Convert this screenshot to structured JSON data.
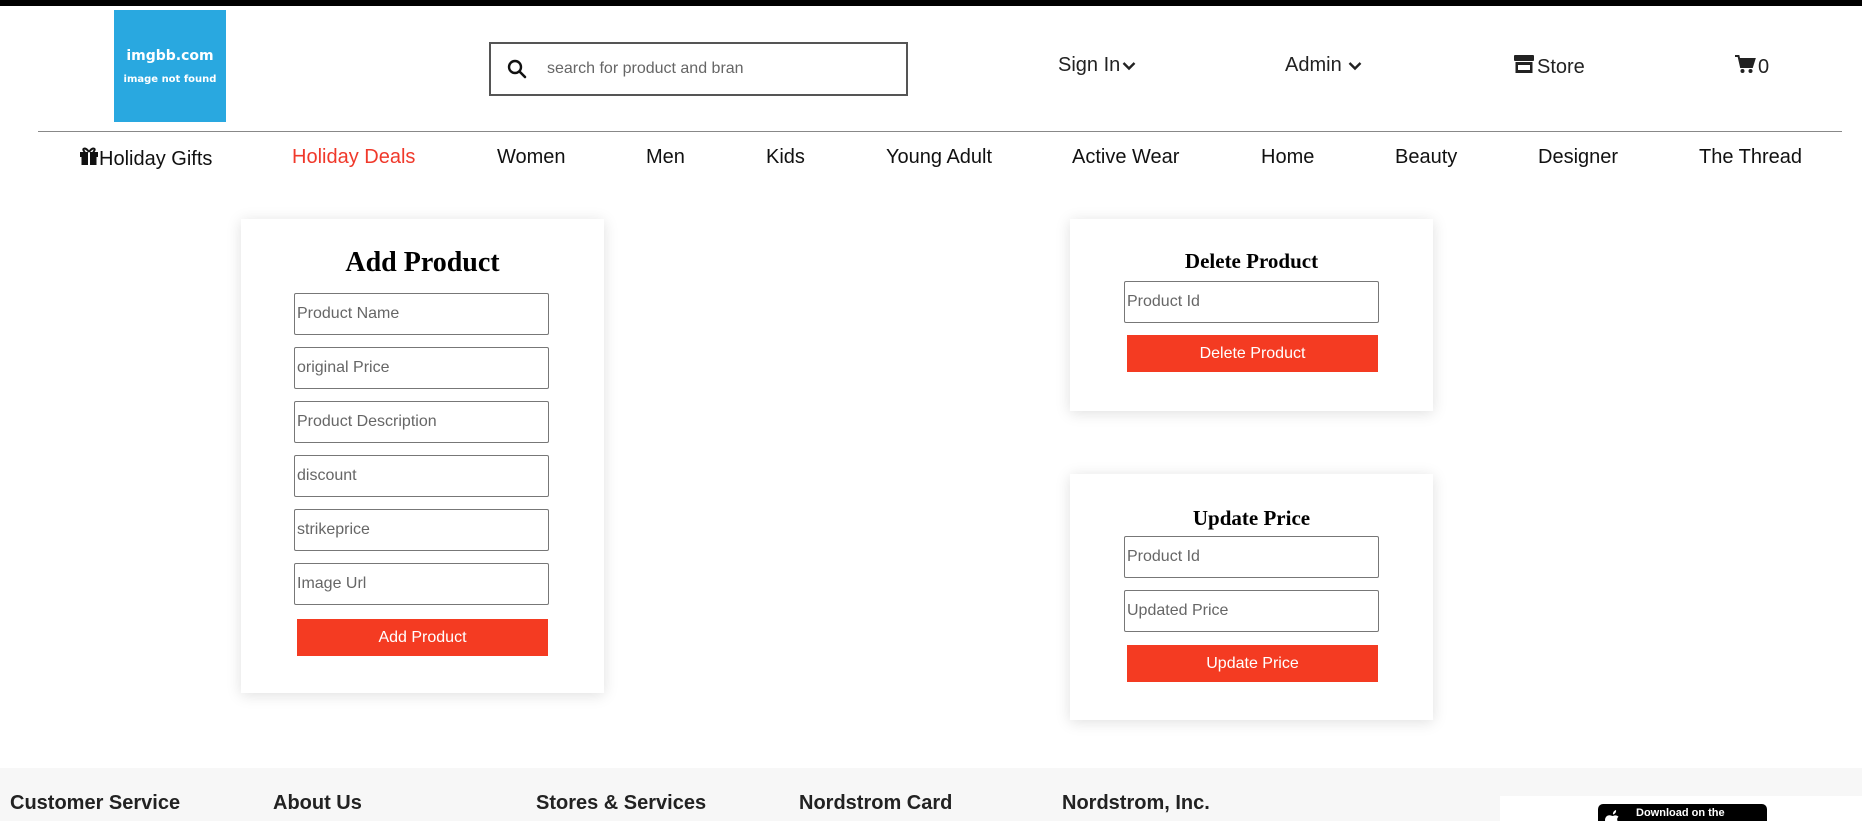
{
  "header": {
    "logo": {
      "line1": "imgbb.com",
      "line2": "image not found"
    },
    "search": {
      "placeholder": "search for product and bran"
    },
    "sign_in": "Sign In",
    "admin": "Admin",
    "store": "Store",
    "cart_count": "0"
  },
  "nav": {
    "items": [
      {
        "label": "Holiday Gifts"
      },
      {
        "label": "Holiday Deals"
      },
      {
        "label": "Women"
      },
      {
        "label": "Men"
      },
      {
        "label": "Kids"
      },
      {
        "label": "Young Adult"
      },
      {
        "label": "Active Wear"
      },
      {
        "label": "Home"
      },
      {
        "label": "Beauty"
      },
      {
        "label": "Designer"
      },
      {
        "label": "The Thread"
      }
    ],
    "active_color": "#f0392b"
  },
  "add_product": {
    "title": "Add Product",
    "fields": [
      {
        "placeholder": "Product Name"
      },
      {
        "placeholder": "original Price"
      },
      {
        "placeholder": "Product Description"
      },
      {
        "placeholder": "discount"
      },
      {
        "placeholder": "strikeprice"
      },
      {
        "placeholder": "Image Url"
      }
    ],
    "button": "Add Product"
  },
  "delete_product": {
    "title": "Delete Product",
    "field_placeholder": "Product Id",
    "button": "Delete Product"
  },
  "update_price": {
    "title": "Update Price",
    "id_placeholder": "Product Id",
    "price_placeholder": "Updated Price",
    "button": "Update Price"
  },
  "footer": {
    "columns": [
      "Customer Service",
      "About Us",
      "Stores & Services",
      "Nordstrom Card",
      "Nordstrom, Inc."
    ],
    "app_badge": "Download on the"
  },
  "colors": {
    "button": "#f43b22",
    "logo_bg": "#29a8e0"
  }
}
